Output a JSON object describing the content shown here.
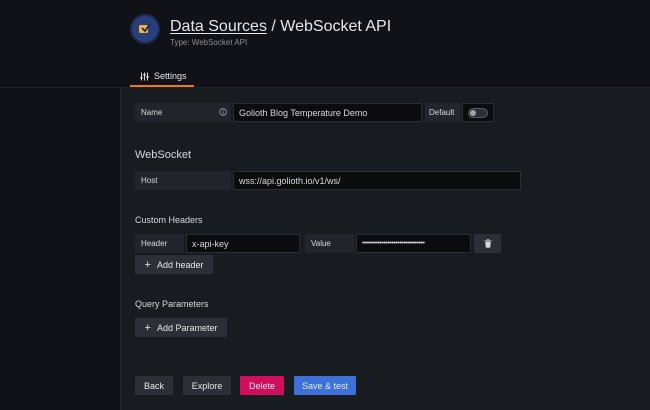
{
  "header": {
    "breadcrumb_link": "Data Sources",
    "separator": " / ",
    "title": "WebSocket API",
    "subtitle": "Type: WebSocket API",
    "logo_icon": "websocket-logo-icon"
  },
  "tabs": [
    {
      "label": "Settings",
      "icon": "sliders-icon",
      "active": true
    }
  ],
  "name_row": {
    "label": "Name",
    "info_icon": "info-circle-icon",
    "value": "Golioth Blog Temperature Demo",
    "default_label": "Default",
    "default_on": false
  },
  "websocket": {
    "section_title": "WebSocket",
    "host_label": "Host",
    "host_value": "wss://api.golioth.io/v1/ws/"
  },
  "custom_headers": {
    "section_title": "Custom Headers",
    "header_label": "Header",
    "header_value": "x-api-key",
    "value_label": "Value",
    "value_masked": "••••••••••••••••••••••••••••••••",
    "delete_icon": "trash-icon",
    "add_label": "Add header"
  },
  "query_parameters": {
    "section_title": "Query Parameters",
    "add_label": "Add Parameter"
  },
  "footer": {
    "back_label": "Back",
    "explore_label": "Explore",
    "delete_label": "Delete",
    "save_label": "Save & test"
  },
  "colors": {
    "accent_tab": "#eb7b18",
    "danger": "#d10e5c",
    "primary": "#3d71d9",
    "background": "#111217",
    "panel": "#181b1f"
  }
}
